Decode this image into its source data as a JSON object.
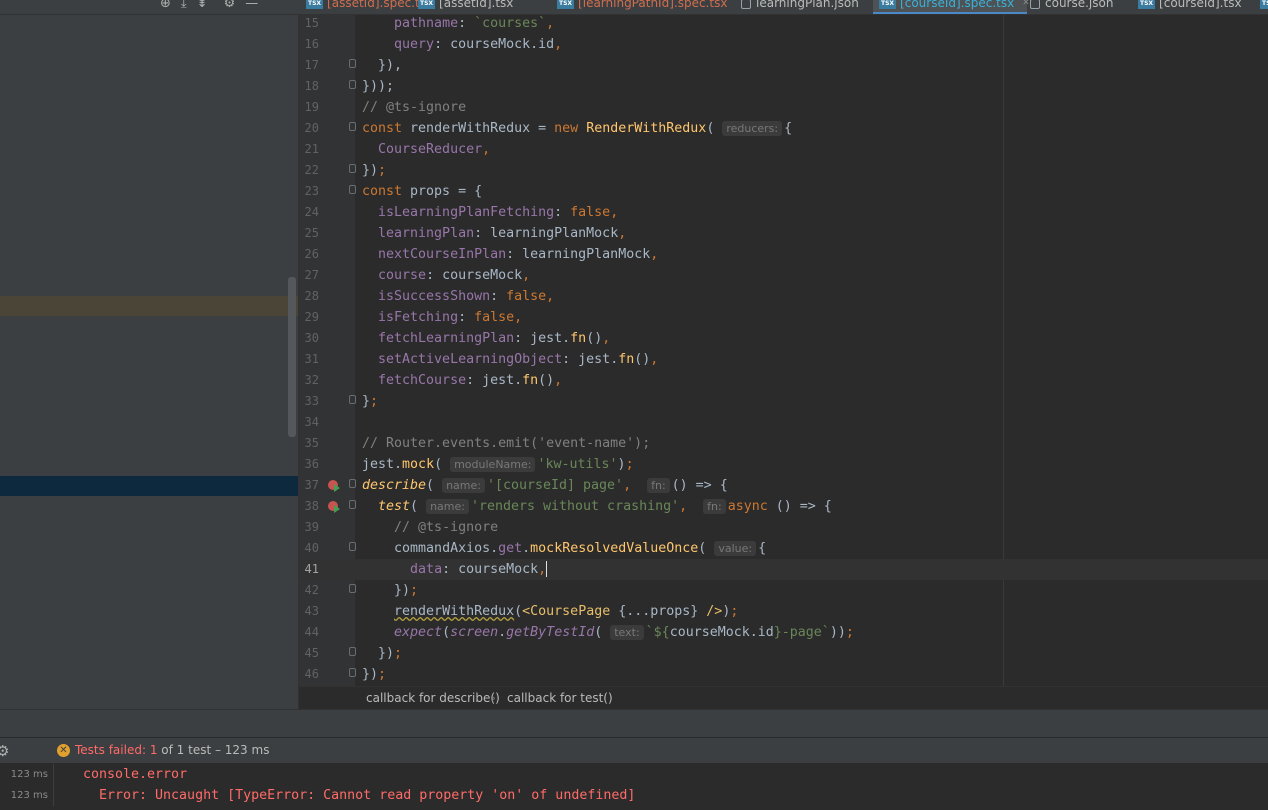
{
  "tabs": [
    {
      "label": "[assetId].spec.tsx",
      "icon": "tsx-icon",
      "state": "error",
      "closable": false
    },
    {
      "label": "[assetId].tsx",
      "icon": "tsx-icon",
      "state": "normal",
      "closable": false
    },
    {
      "label": "[learningPathId].spec.tsx",
      "icon": "tsx-icon",
      "state": "error",
      "closable": false
    },
    {
      "label": "learningPlan.json",
      "icon": "json-icon",
      "state": "normal",
      "closable": false
    },
    {
      "label": "[courseId].spec.tsx",
      "icon": "tsx-icon",
      "state": "active",
      "closable": true
    },
    {
      "label": "course.json",
      "icon": "json-icon",
      "state": "normal",
      "closable": false
    },
    {
      "label": "[courseId].tsx",
      "icon": "tsx-icon",
      "state": "normal",
      "closable": false
    }
  ],
  "tab_icon_text": "TSX",
  "close_glyph": "✕",
  "toolbar": {
    "locate_icon": "⊕",
    "collapse_icon": "⤓",
    "expand_icon": "⇟",
    "settings_icon": "⚙",
    "hide_icon": "—"
  },
  "editor": {
    "current_line": 41,
    "lines": [
      {
        "n": "15",
        "code": "    pathname: `courses`,"
      },
      {
        "n": "16",
        "code": "    query: courseMock.id,"
      },
      {
        "n": "17",
        "code": "  }),"
      },
      {
        "n": "18",
        "code": "}));"
      },
      {
        "n": "19",
        "code": "// @ts-ignore"
      },
      {
        "n": "20",
        "code": "const renderWithRedux = new RenderWithRedux( reducers: {"
      },
      {
        "n": "21",
        "code": "  CourseReducer,"
      },
      {
        "n": "22",
        "code": "});"
      },
      {
        "n": "23",
        "code": "const props = {"
      },
      {
        "n": "24",
        "code": "  isLearningPlanFetching: false,"
      },
      {
        "n": "25",
        "code": "  learningPlan: learningPlanMock,"
      },
      {
        "n": "26",
        "code": "  nextCourseInPlan: learningPlanMock,"
      },
      {
        "n": "27",
        "code": "  course: courseMock,"
      },
      {
        "n": "28",
        "code": "  isSuccessShown: false,"
      },
      {
        "n": "29",
        "code": "  isFetching: false,"
      },
      {
        "n": "30",
        "code": "  fetchLearningPlan: jest.fn(),"
      },
      {
        "n": "31",
        "code": "  setActiveLearningObject: jest.fn(),"
      },
      {
        "n": "32",
        "code": "  fetchCourse: jest.fn(),"
      },
      {
        "n": "33",
        "code": "};"
      },
      {
        "n": "34",
        "code": ""
      },
      {
        "n": "35",
        "code": "// Router.events.emit('event-name');"
      },
      {
        "n": "36",
        "code": "jest.mock( moduleName: 'kw-utils');"
      },
      {
        "n": "37",
        "code": "describe( name: '[courseId] page',  fn: () => {"
      },
      {
        "n": "38",
        "code": "  test( name: 'renders without crashing',  fn: async () => {"
      },
      {
        "n": "39",
        "code": "    // @ts-ignore"
      },
      {
        "n": "40",
        "code": "    commandAxios.get.mockResolvedValueOnce( value: {"
      },
      {
        "n": "41",
        "code": "      data: courseMock,"
      },
      {
        "n": "42",
        "code": "    });"
      },
      {
        "n": "43",
        "code": "    renderWithRedux(<CoursePage {...props} />);"
      },
      {
        "n": "44",
        "code": "    expect(screen.getByTestId( text: `${courseMock.id}-page`));"
      },
      {
        "n": "45",
        "code": "  });"
      },
      {
        "n": "46",
        "code": "});"
      }
    ],
    "hints": {
      "reducers": "reducers:",
      "moduleName": "moduleName:",
      "name": "name:",
      "fn": "fn:",
      "value": "value:",
      "text": "text:"
    },
    "fragments": {
      "l15_key": "pathname",
      "l15_val": "`courses`",
      "l16_key": "query",
      "l16_val": "courseMock.id",
      "l17": "}),",
      "l18": "}));",
      "l19": "// @ts-ignore",
      "l20_kw": "const",
      "l20_var": "renderWithRedux",
      "l20_eq": " = ",
      "l20_new": "new",
      "l20_cls": "RenderWithRedux",
      "l20_open": "(",
      "l20_brace": "{",
      "l21": "CourseReducer",
      "l22": "});",
      "l23_kw": "const",
      "l23_rest": " props = {",
      "l24_k": "isLearningPlanFetching",
      "l24_v": "false",
      "l25_k": "learningPlan",
      "l25_v": "learningPlanMock",
      "l26_k": "nextCourseInPlan",
      "l26_v": "learningPlanMock",
      "l27_k": "course",
      "l27_v": "courseMock",
      "l28_k": "isSuccessShown",
      "l28_v": "false",
      "l29_k": "isFetching",
      "l29_v": "false",
      "l30_k": "fetchLearningPlan",
      "l31_k": "setActiveLearningObject",
      "l32_k": "fetchCourse",
      "jest": "jest",
      "fn": "fn",
      "mock": "mock",
      "l33": "};",
      "l35": "// Router.events.emit('event-name');",
      "l36_str": "'kw-utils'",
      "l37_fn": "describe",
      "l37_str": "'[courseId] page'",
      "l37_arrow": "() => {",
      "l38_fn": "test",
      "l38_str": "'renders without crashing'",
      "l38_async": "async",
      "l38_arrow": " () => {",
      "l39": "// @ts-ignore",
      "l40_obj": "commandAxios",
      "l40_get": "get",
      "l40_m": "mockResolvedValueOnce",
      "l40_brace": "{",
      "l41_k": "data",
      "l41_v": "courseMock",
      "l42": "});",
      "l43_fn": "renderWithRedux",
      "l43_tag": "CoursePage",
      "l43_props": " {...props} ",
      "l44_fn": "expect",
      "l44_screen": "screen",
      "l44_get": "getByTestId",
      "l44_str_a": "`${",
      "l44_str_mid": "courseMock.id",
      "l44_str_b": "}-page`",
      "l45": "});",
      "l46": "});"
    }
  },
  "breadcrumb": {
    "item1": "callback for describe()",
    "separator": "›",
    "item2": "callback for test()"
  },
  "test_run": {
    "gear_icon": "⚙",
    "status_label": "Tests failed:",
    "failed_count": "1",
    "summary": " of 1 test – 123 ms",
    "console": [
      {
        "time": "123 ms",
        "text": "console.error"
      },
      {
        "time": "123 ms",
        "text": "Error: Uncaught [TypeError: Cannot read property 'on' of undefined]"
      }
    ]
  }
}
